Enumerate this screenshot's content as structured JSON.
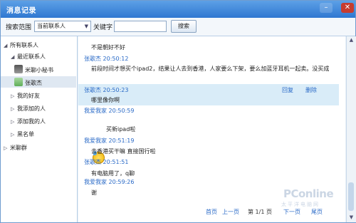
{
  "window": {
    "title": "消息记录"
  },
  "search": {
    "range_label": "搜索范围",
    "range_value": "当前联系人",
    "keyword_label": "关键字",
    "keyword_value": "",
    "button_label": "搜索"
  },
  "sidebar": {
    "all_contacts": "所有联系人",
    "recent": "最近联系人",
    "contact_1": "米聊小秘书",
    "contact_2": "张歌杰",
    "friends": "我的好友",
    "added_by_me": "我添加的人",
    "added_me": "添加我的人",
    "blacklist": "黑名单",
    "groups": "米聊群"
  },
  "messages": {
    "m0_body": "不是朝好不好",
    "m1_name": "张歌杰 20:50:12",
    "m1_body": "前段时间才想买个ipad2，结果让人去到香港，人家要么下架，要么加蓝牙耳机一起卖。没买成",
    "m2_name": "张歌杰 20:50:23",
    "m2_body": "哪里像你啊",
    "m3_name": "我爱我家 20:50:59",
    "m3_body": "买新ipad啦",
    "m4_name": "我爱我家 20:51:19",
    "m4_body": "去香港买干嘛 直接国行啦",
    "m5_name": "张歌杰 20:51:51",
    "m5_body": "有电脑用了，q聊",
    "m6_name": "我爱我家 20:59:26",
    "m6_body": "谢"
  },
  "actions": {
    "reply": "回复",
    "delete": "删除"
  },
  "pager": {
    "first": "首页",
    "prev": "上一页",
    "page": "第 1/1 页",
    "next": "下一页",
    "last": "尾页"
  },
  "watermark": {
    "text": "PConline",
    "sub": "太平洋电脑网"
  },
  "colors": {
    "accent": "#2a6ac7",
    "titlebar": "#2f78d1",
    "highlight": "#d9ecf8"
  }
}
